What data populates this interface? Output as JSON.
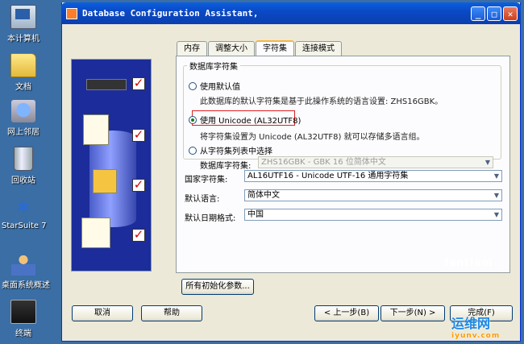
{
  "desktop": {
    "icons": [
      {
        "label": "本计算机"
      },
      {
        "label": "文档"
      },
      {
        "label": "网上邻居"
      },
      {
        "label": "回收站"
      },
      {
        "label": "StarSuite 7"
      },
      {
        "label": "桌面系统概述"
      },
      {
        "label": "终端"
      }
    ]
  },
  "window": {
    "title": "Database Configuration Assistant,",
    "tabs": [
      "内存",
      "调整大小",
      "字符集",
      "连接模式"
    ],
    "active_tab": "字符集"
  },
  "charset": {
    "group_label": "数据库字符集",
    "opt_default": "使用默认值",
    "opt_default_hint": "此数据库的默认字符集是基于此操作系统的语言设置: ZHS16GBK。",
    "opt_unicode": "使用 Unicode (AL32UTF8)",
    "opt_unicode_hint": "将字符集设置为 Unicode (AL32UTF8) 就可以存储多语言组。",
    "opt_list": "从字符集列表中选择",
    "db_charset_label": "数据库字符集:",
    "db_charset_value": "ZHS16GBK - GBK 16 位简体中文",
    "selected": "unicode"
  },
  "national": {
    "label": "国家字符集:",
    "value": "AL16UTF16 - Unicode UTF-16 通用字符集"
  },
  "language": {
    "label": "默认语言:",
    "value": "简体中文"
  },
  "date_format": {
    "label": "默认日期格式:",
    "value": "中国"
  },
  "buttons": {
    "all_params": "所有初始化参数...",
    "cancel": "取消",
    "help": "帮助",
    "back": "< 上一步(B)",
    "next": "下一步(N) >",
    "finish": "完成(F)"
  },
  "watermark": {
    "author": "fantiam",
    "site": "运维网",
    "site_sub": "iyunv.com"
  }
}
